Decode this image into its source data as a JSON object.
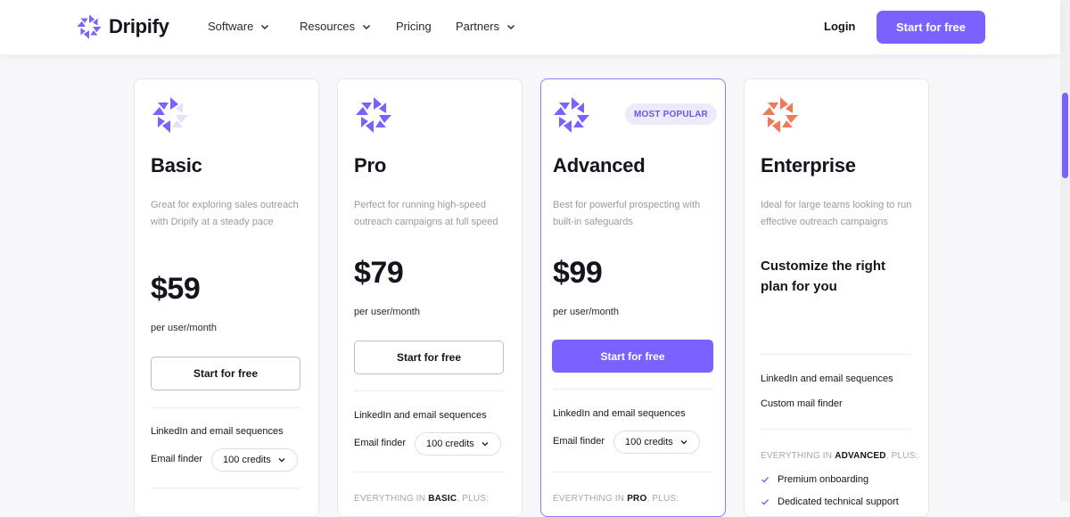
{
  "brand": {
    "name": "Dripify",
    "accent": "#7b61ff",
    "enterprise_accent": "#f07a55"
  },
  "nav": {
    "items": [
      {
        "label": "Software",
        "dropdown": true
      },
      {
        "label": "Resources",
        "dropdown": true
      },
      {
        "label": "Pricing",
        "dropdown": false
      },
      {
        "label": "Partners",
        "dropdown": true
      }
    ],
    "login": "Login",
    "cta": "Start for free"
  },
  "plans": [
    {
      "name": "Basic",
      "description": "Great for exploring sales outreach with Dripify at a steady pace",
      "price": "$59",
      "period": "per user/month",
      "cta": "Start for free",
      "features": [
        "LinkedIn and email sequences"
      ],
      "email_finder_label": "Email finder",
      "credits": "100 credits",
      "icon": "dripify-logo-icon-light"
    },
    {
      "name": "Pro",
      "description": "Perfect for running high-speed outreach campaigns at full speed",
      "price": "$79",
      "period": "per user/month",
      "cta": "Start for free",
      "features": [
        "LinkedIn and email sequences"
      ],
      "email_finder_label": "Email finder",
      "credits": "100 credits",
      "everything_prefix": "EVERYTHING IN ",
      "everything_plan": "BASIC",
      "everything_suffix": ", PLUS:",
      "icon": "dripify-logo-icon"
    },
    {
      "name": "Advanced",
      "badge": "MOST POPULAR",
      "description": "Best for powerful prospecting with built-in safeguards",
      "price": "$99",
      "period": "per user/month",
      "cta": "Start for free",
      "features": [
        "LinkedIn and email sequences"
      ],
      "email_finder_label": "Email finder",
      "credits": "100 credits",
      "everything_prefix": "EVERYTHING IN ",
      "everything_plan": "PRO",
      "everything_suffix": ", PLUS:",
      "icon": "dripify-logo-icon"
    },
    {
      "name": "Enterprise",
      "description": "Ideal for large teams looking to run effective outreach campaigns",
      "custom": "Customize the right plan for you",
      "features": [
        "LinkedIn and email sequences",
        "Custom mail finder"
      ],
      "everything_prefix": "EVERYTHING IN ",
      "everything_plan": "ADVANCED",
      "everything_suffix": ", PLUS:",
      "extras": [
        "Premium onboarding",
        "Dedicated technical support"
      ],
      "icon": "dripify-logo-icon-orange"
    }
  ]
}
